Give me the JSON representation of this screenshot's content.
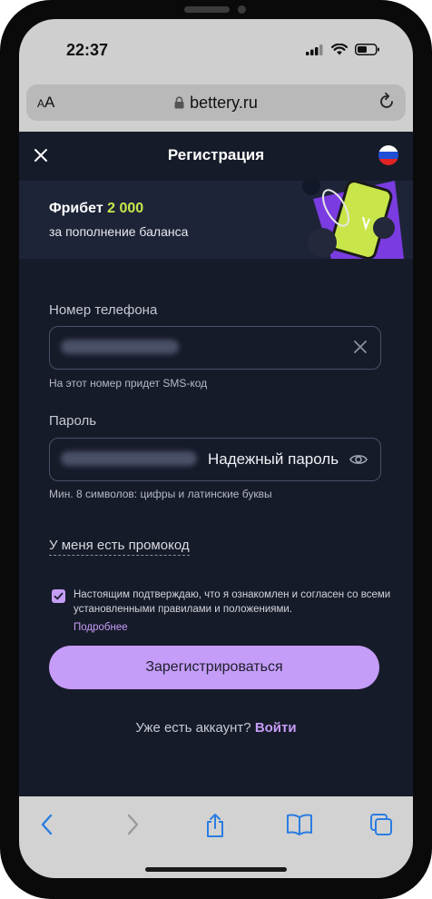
{
  "status": {
    "time": "22:37"
  },
  "browser": {
    "text_size_label_small": "A",
    "text_size_label_big": "A",
    "url": "bettery.ru"
  },
  "header": {
    "title": "Регистрация"
  },
  "banner": {
    "title_prefix": "Фрибет",
    "amount": "2 000",
    "subtitle": "за пополнение баланса"
  },
  "form": {
    "phone_label": "Номер телефона",
    "phone_hint": "На этот номер придет SMS-код",
    "password_label": "Пароль",
    "password_strength": "Надежный пароль",
    "password_hint": "Мин. 8 символов: цифры и латинские буквы",
    "promo_link": "У меня есть промокод",
    "consent_text": "Настоящим подтверждаю, что я ознакомлен и согласен со всеми установленными правилами и положениями.",
    "consent_more": "Подробнее",
    "consent_checked": true,
    "submit": "Зарегистрироваться",
    "login_prompt": "Уже есть аккаунт?",
    "login_link": "Войти"
  },
  "colors": {
    "accent": "#c59cf7",
    "highlight": "#c9e84a",
    "background": "#161b2a"
  }
}
